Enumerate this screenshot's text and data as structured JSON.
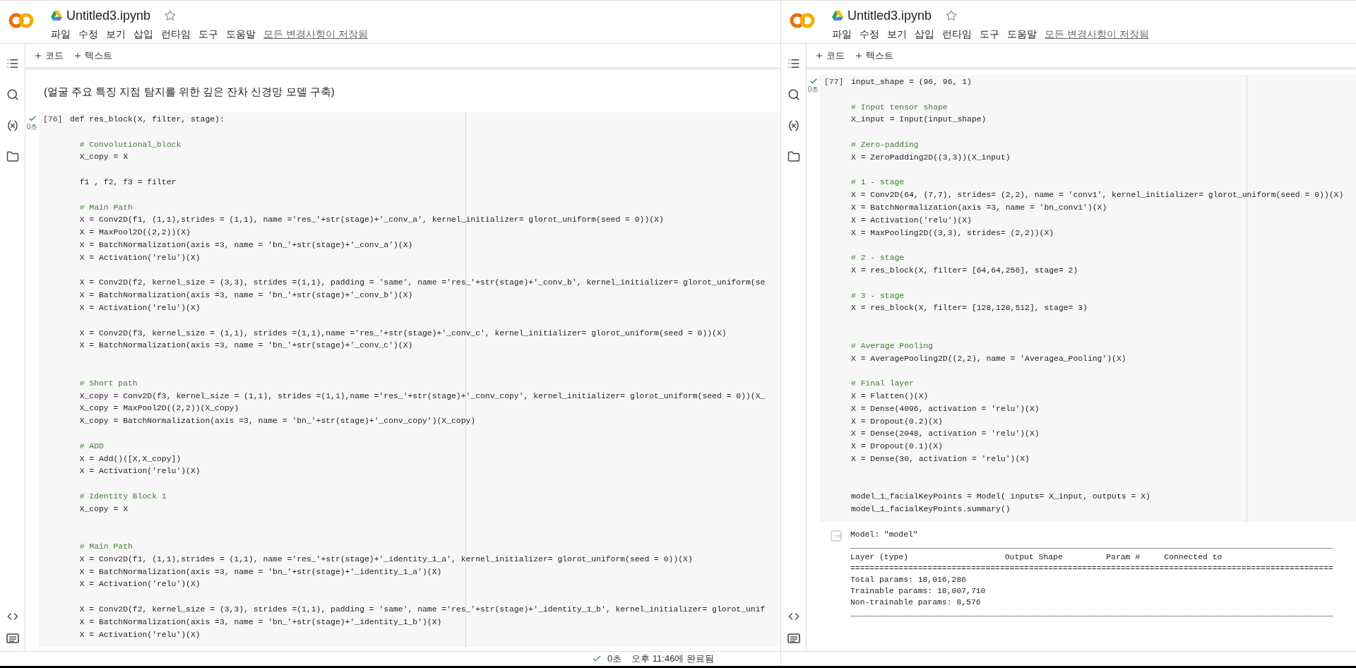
{
  "windows": [
    {
      "title": "Untitled3.ipynb",
      "menu": [
        "파일",
        "수정",
        "보기",
        "삽입",
        "런타임",
        "도구",
        "도움말"
      ],
      "save_status": "모든 변경사항이 저장됨",
      "toolbar": [
        "코드",
        "텍스트"
      ],
      "cells": [
        {
          "kind": "text",
          "text": "(얼굴 주요 특징 지점 탐지를 위한 깊은 잔차 신경망 모델 구축)"
        },
        {
          "kind": "code",
          "execution_count": "[76]",
          "run_time": "0초",
          "executed": true,
          "lines": [
            {
              "kind": "code",
              "text": "def res_block(X, filter, stage):"
            },
            {
              "kind": "blank"
            },
            {
              "kind": "comment",
              "text": "  # Convolutional_block"
            },
            {
              "kind": "code",
              "text": "  X_copy = X"
            },
            {
              "kind": "blank"
            },
            {
              "kind": "code",
              "text": "  f1 , f2, f3 = filter"
            },
            {
              "kind": "blank"
            },
            {
              "kind": "comment",
              "text": "  # Main Path"
            },
            {
              "kind": "code",
              "text": "  X = Conv2D(f1, (1,1),strides = (1,1), name ='res_'+str(stage)+'_conv_a', kernel_initializer= glorot_uniform(seed = 0))(X)"
            },
            {
              "kind": "code",
              "text": "  X = MaxPool2D((2,2))(X)"
            },
            {
              "kind": "code",
              "text": "  X = BatchNormalization(axis =3, name = 'bn_'+str(stage)+'_conv_a')(X)"
            },
            {
              "kind": "code",
              "text": "  X = Activation('relu')(X)"
            },
            {
              "kind": "blank"
            },
            {
              "kind": "code",
              "text": "  X = Conv2D(f2, kernel_size = (3,3), strides =(1,1), padding = 'same', name ='res_'+str(stage)+'_conv_b', kernel_initializer= glorot_uniform(se"
            },
            {
              "kind": "code",
              "text": "  X = BatchNormalization(axis =3, name = 'bn_'+str(stage)+'_conv_b')(X)"
            },
            {
              "kind": "code",
              "text": "  X = Activation('relu')(X)"
            },
            {
              "kind": "blank"
            },
            {
              "kind": "code",
              "text": "  X = Conv2D(f3, kernel_size = (1,1), strides =(1,1),name ='res_'+str(stage)+'_conv_c', kernel_initializer= glorot_uniform(seed = 0))(X)"
            },
            {
              "kind": "code",
              "text": "  X = BatchNormalization(axis =3, name = 'bn_'+str(stage)+'_conv_c')(X)"
            },
            {
              "kind": "blank"
            },
            {
              "kind": "blank"
            },
            {
              "kind": "comment",
              "text": "  # Short path"
            },
            {
              "kind": "code",
              "text": "  X_copy = Conv2D(f3, kernel_size = (1,1), strides =(1,1),name ='res_'+str(stage)+'_conv_copy', kernel_initializer= glorot_uniform(seed = 0))(X_"
            },
            {
              "kind": "code",
              "text": "  X_copy = MaxPool2D((2,2))(X_copy)"
            },
            {
              "kind": "code",
              "text": "  X_copy = BatchNormalization(axis =3, name = 'bn_'+str(stage)+'_conv_copy')(X_copy)"
            },
            {
              "kind": "blank"
            },
            {
              "kind": "comment",
              "text": "  # ADD"
            },
            {
              "kind": "code",
              "text": "  X = Add()([X,X_copy])"
            },
            {
              "kind": "code",
              "text": "  X = Activation('relu')(X)"
            },
            {
              "kind": "blank"
            },
            {
              "kind": "comment",
              "text": "  # Identity Block 1"
            },
            {
              "kind": "code",
              "text": "  X_copy = X"
            },
            {
              "kind": "blank"
            },
            {
              "kind": "blank"
            },
            {
              "kind": "comment",
              "text": "  # Main Path"
            },
            {
              "kind": "code",
              "text": "  X = Conv2D(f1, (1,1),strides = (1,1), name ='res_'+str(stage)+'_identity_1_a', kernel_initializer= glorot_uniform(seed = 0))(X)"
            },
            {
              "kind": "code",
              "text": "  X = BatchNormalization(axis =3, name = 'bn_'+str(stage)+'_identity_1_a')(X)"
            },
            {
              "kind": "code",
              "text": "  X = Activation('relu')(X)"
            },
            {
              "kind": "blank"
            },
            {
              "kind": "code",
              "text": "  X = Conv2D(f2, kernel_size = (3,3), strides =(1,1), padding = 'same', name ='res_'+str(stage)+'_identity_1_b', kernel_initializer= glorot_unif"
            },
            {
              "kind": "code",
              "text": "  X = BatchNormalization(axis =3, name = 'bn_'+str(stage)+'_identity_1_b')(X)"
            },
            {
              "kind": "code",
              "text": "  X = Activation('relu')(X)"
            }
          ]
        }
      ],
      "status_bar": {
        "duration": "0초",
        "message": "오후 11:46에 완료됨"
      }
    },
    {
      "title": "Untitled3.ipynb",
      "menu": [
        "파일",
        "수정",
        "보기",
        "삽입",
        "런타임",
        "도구",
        "도움말"
      ],
      "save_status": "모든 변경사항이 저장됨",
      "toolbar": [
        "코드",
        "텍스트"
      ],
      "cells": [
        {
          "kind": "code",
          "execution_count": "[77]",
          "run_time": "0초",
          "executed": true,
          "lines": [
            {
              "kind": "code",
              "text": "input_shape = (96, 96, 1)"
            },
            {
              "kind": "blank"
            },
            {
              "kind": "comment",
              "text": "# Input tensor shape"
            },
            {
              "kind": "code",
              "text": "X_input = Input(input_shape)"
            },
            {
              "kind": "blank"
            },
            {
              "kind": "comment",
              "text": "# Zero-padding"
            },
            {
              "kind": "code",
              "text": "X = ZeroPadding2D((3,3))(X_input)"
            },
            {
              "kind": "blank"
            },
            {
              "kind": "comment",
              "text": "# 1 - stage"
            },
            {
              "kind": "code",
              "text": "X = Conv2D(64, (7,7), strides= (2,2), name = 'conv1', kernel_initializer= glorot_uniform(seed = 0))(X)"
            },
            {
              "kind": "code",
              "text": "X = BatchNormalization(axis =3, name = 'bn_conv1')(X)"
            },
            {
              "kind": "code",
              "text": "X = Activation('relu')(X)"
            },
            {
              "kind": "code",
              "text": "X = MaxPooling2D((3,3), strides= (2,2))(X)"
            },
            {
              "kind": "blank"
            },
            {
              "kind": "comment",
              "text": "# 2 - stage"
            },
            {
              "kind": "code",
              "text": "X = res_block(X, filter= [64,64,256], stage= 2)"
            },
            {
              "kind": "blank"
            },
            {
              "kind": "comment",
              "text": "# 3 - stage"
            },
            {
              "kind": "code",
              "text": "X = res_block(X, filter= [128,128,512], stage= 3)"
            },
            {
              "kind": "blank"
            },
            {
              "kind": "blank"
            },
            {
              "kind": "comment",
              "text": "# Average Pooling"
            },
            {
              "kind": "code",
              "text": "X = AveragePooling2D((2,2), name = 'Averagea_Pooling')(X)"
            },
            {
              "kind": "blank"
            },
            {
              "kind": "comment",
              "text": "# Final layer"
            },
            {
              "kind": "code",
              "text": "X = Flatten()(X)"
            },
            {
              "kind": "code",
              "text": "X = Dense(4096, activation = 'relu')(X)"
            },
            {
              "kind": "code",
              "text": "X = Dropout(0.2)(X)"
            },
            {
              "kind": "code",
              "text": "X = Dense(2048, activation = 'relu')(X)"
            },
            {
              "kind": "code",
              "text": "X = Dropout(0.1)(X)"
            },
            {
              "kind": "code",
              "text": "X = Dense(30, activation = 'relu')(X)"
            },
            {
              "kind": "blank"
            },
            {
              "kind": "blank"
            },
            {
              "kind": "code",
              "text": "model_1_facialKeyPoints = Model( inputs= X_input, outputs = X)"
            },
            {
              "kind": "code",
              "text": "model_1_facialKeyPoints.summary()"
            }
          ],
          "output": [
            "Model: \"model\"",
            "____________________________________________________________________________________________________",
            "Layer (type)                    Output Shape         Param #     Connected to",
            "====================================================================================================",
            "Total params: 18,016,286",
            "Trainable params: 18,007,710",
            "Non-trainable params: 8,576",
            "____________________________________________________________________________________________________"
          ]
        }
      ]
    }
  ]
}
